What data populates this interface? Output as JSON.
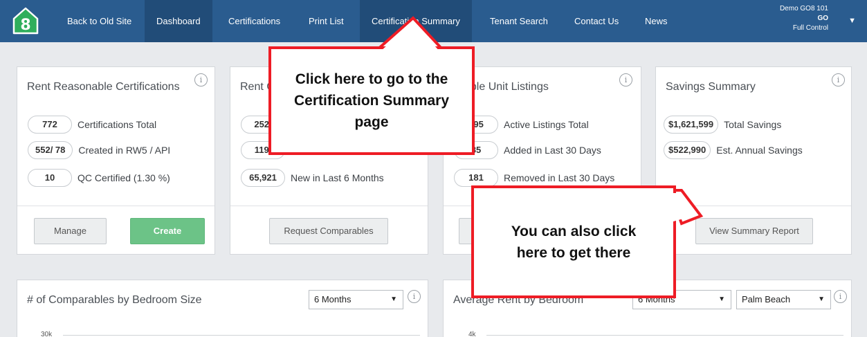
{
  "nav": {
    "items": [
      {
        "label": "Back to Old Site"
      },
      {
        "label": "Dashboard"
      },
      {
        "label": "Certifications"
      },
      {
        "label": "Print List"
      },
      {
        "label": "Certification Summary"
      },
      {
        "label": "Tenant Search"
      },
      {
        "label": "Contact Us"
      },
      {
        "label": "News"
      }
    ],
    "user": {
      "org": "Demo GO8 101",
      "name": "GO",
      "role": "Full Control"
    }
  },
  "cards": {
    "rent_reasonable": {
      "title": "Rent Reasonable Certifications",
      "stats": [
        {
          "value": "772",
          "label": "Certifications Total"
        },
        {
          "value": "552/ 78",
          "label": "Created in RW5 / API"
        },
        {
          "value": "10",
          "label": "QC Certified (1.30 %)"
        }
      ],
      "manage_label": "Manage",
      "create_label": "Create"
    },
    "comparables": {
      "title": "Rent C",
      "stats": [
        {
          "value": "252,",
          "label": ""
        },
        {
          "value": "119,",
          "label": ""
        },
        {
          "value": "65,921",
          "label": "New in Last 6 Months"
        }
      ],
      "request_label": "Request Comparables"
    },
    "unit_listings": {
      "title": "able Unit Listings",
      "stats": [
        {
          "value": "395",
          "label": "Active Listings Total"
        },
        {
          "value": "85",
          "label": "Added in Last 30 Days"
        },
        {
          "value": "181",
          "label": "Removed in Last 30 Days"
        }
      ]
    },
    "savings": {
      "title": "Savings Summary",
      "stats": [
        {
          "value": "$1,621,599",
          "label": "Total Savings"
        },
        {
          "value": "$522,990",
          "label": "Est. Annual Savings"
        }
      ],
      "report_label": "View Summary Report"
    },
    "bedroom_chart": {
      "title": "# of Comparables by Bedroom Size",
      "period": "6 Months",
      "ytick": "30k"
    },
    "rent_chart": {
      "title": "Average Rent by Bedroom",
      "period": "6 Months",
      "region": "Palm Beach",
      "ytick": "4k"
    }
  },
  "callouts": {
    "top": "Click here to go to the Certification Summary page",
    "bottom": "You can also click here to get there",
    "border_color": "#ee1c25"
  },
  "icons": {
    "info": "i",
    "caret": "▼"
  }
}
